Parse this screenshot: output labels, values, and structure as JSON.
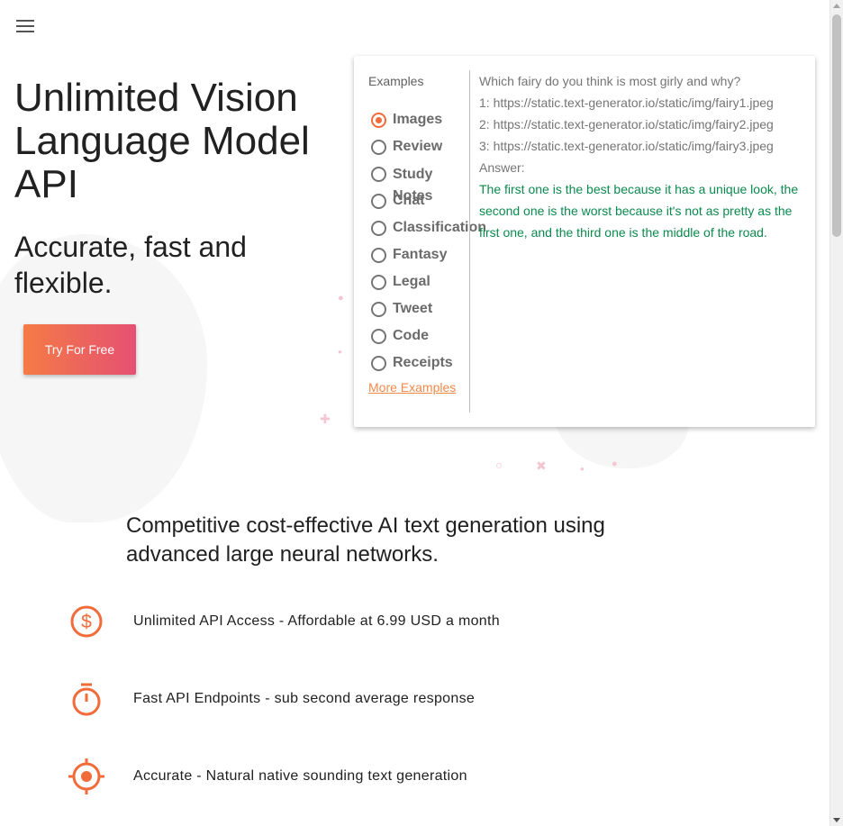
{
  "header": {
    "menu_icon": "hamburger-menu-icon"
  },
  "hero": {
    "title": "Unlimited Vision Language Model API",
    "subtitle": "Accurate, fast and flexible.",
    "cta_label": "Try For Free"
  },
  "examples": {
    "heading": "Examples",
    "selected": "Images",
    "items": [
      "Images",
      "Review",
      "Study Notes",
      "Chat",
      "Classification",
      "Fantasy",
      "Legal",
      "Tweet",
      "Code",
      "Receipts"
    ],
    "more_link": "More Examples",
    "prompt_lines": [
      "Which fairy do you think is most girly and why?",
      "1: https://static.text-generator.io/static/img/fairy1.jpeg",
      "2: https://static.text-generator.io/static/img/fairy2.jpeg",
      "3: https://static.text-generator.io/static/img/fairy3.jpeg",
      "Answer:"
    ],
    "answer": "The first one is the best because it has a unique look, the second one is the worst because it's not as pretty as the first one, and the third one is the middle of the road."
  },
  "features": {
    "heading": "Competitive cost-effective AI text generation using advanced large neural networks.",
    "items": [
      {
        "icon": "dollar-circle-icon",
        "text": "Unlimited API Access - Affordable at 6.99 USD a month"
      },
      {
        "icon": "stopwatch-icon",
        "text": "Fast API Endpoints - sub second average response"
      },
      {
        "icon": "crosshair-target-icon",
        "text": "Accurate - Natural native sounding text generation"
      }
    ]
  },
  "colors": {
    "accent": "#f26b3a",
    "gradient_start": "#f57b46",
    "gradient_end": "#e55072",
    "answer_text": "#0b8a4d"
  }
}
